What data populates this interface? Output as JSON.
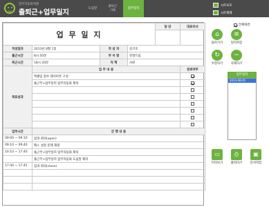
{
  "app": {
    "subtitle": "업무자동화엑셀",
    "title": "출퇴근+업무일지"
  },
  "tabs": [
    {
      "label": "도움말"
    },
    {
      "label": "출퇴근\n기록"
    },
    {
      "label": "업무일지"
    }
  ],
  "toolbar": {
    "save": "시트보호",
    "clear": "시트해제"
  },
  "sheet": {
    "title": "업 무 일 지",
    "approvals": {
      "h1": "담 당",
      "h2": "대표이사"
    },
    "fields": {
      "date_label": "작성일자",
      "date_value": "2013년 8월 1일",
      "writer_label": "작 성 자",
      "writer_value": "김기호",
      "in_label": "출근시간",
      "in_value": "8시 50분",
      "dept_label": "부 서 명",
      "dept_value": "헌영드림",
      "out_label": "퇴근시간",
      "out_value": "18시 20분",
      "rank_label": "직 책",
      "rank_value": "사원"
    },
    "goal": {
      "label": "목표성과",
      "col_task": "업 무 내 용",
      "col_done": "완료여부",
      "rows": [
        {
          "text": "엑셀입 함수 레이아웃 구성",
          "done": true
        },
        {
          "text": "출근부+업무일지 업무자동화 제작",
          "done": true
        },
        {
          "text": "",
          "done": false
        },
        {
          "text": "",
          "done": false
        },
        {
          "text": "",
          "done": false
        },
        {
          "text": "",
          "done": false
        },
        {
          "text": "",
          "done": false
        },
        {
          "text": "",
          "done": false
        }
      ]
    },
    "log": {
      "col_time": "업무시간",
      "col_detail": "진 행 내 용",
      "rows": [
        {
          "start": "09:00",
          "end": "09:10",
          "detail": "업과 회의(open)"
        },
        {
          "start": "09:10",
          "end": "09:40",
          "detail": "팩스 설정 문제 해결"
        },
        {
          "start": "10:10",
          "end": "17:40",
          "detail": "출근부+업무일지 업무자동화 제작"
        },
        {
          "start": "",
          "end": "",
          "detail": "출근부+업무일지 업무자동화 도움말 제작"
        },
        {
          "start": "17:40",
          "end": "17:45",
          "detail": "업과 회의(close)"
        },
        {
          "start": "",
          "end": "",
          "detail": ""
        },
        {
          "start": "",
          "end": "",
          "detail": ""
        },
        {
          "start": "",
          "end": "",
          "detail": ""
        }
      ]
    }
  },
  "side": {
    "toggle": "전체화면",
    "b_new": "돌아가기",
    "b_list": "일지저장",
    "b_edit": "수정하기",
    "b_del": "삭제하기",
    "list_header": "업무일지",
    "list_items": [
      "2013-08-01"
    ],
    "b_preview": "미리보기",
    "b_print": "출력하기",
    "b_save": "문서저장"
  },
  "colors": {
    "accent": "#6db33f",
    "topbar": "#4a4a4a"
  }
}
